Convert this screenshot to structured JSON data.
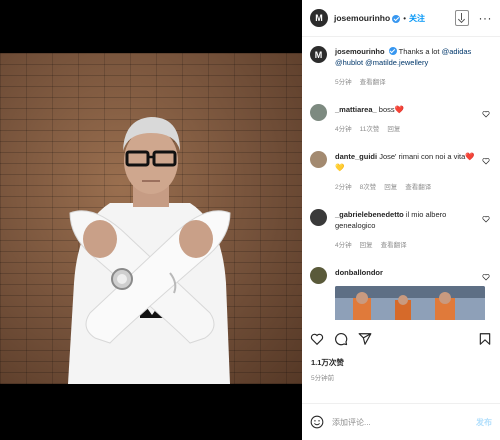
{
  "post": {
    "username": "josemourinho",
    "avatar_initial": "M",
    "follow_label": "关注",
    "dot": "•",
    "more_label": "···",
    "caption": {
      "text": "Thanks a lot ",
      "mentions": [
        "@adidas",
        "@hublot",
        "@matilde.jewellery"
      ],
      "time": "5分钟",
      "translate": "查看翻译"
    },
    "comments": [
      {
        "user": "_mattiarea_",
        "text": "boss",
        "emoji": "❤️",
        "time": "4分钟",
        "likes": "11次赞",
        "reply": "回复"
      },
      {
        "user": "dante_guidi",
        "text": "Jose' rimani con noi a vita",
        "emoji": "❤️💛",
        "time": "2分钟",
        "likes": "8次赞",
        "reply": "回复",
        "translate": "查看翻译"
      },
      {
        "user": "_gabrielebenedetto",
        "text": "il mio albero genealogico",
        "emoji": "",
        "time": "4分钟",
        "reply": "回复",
        "translate": "查看翻译"
      },
      {
        "user": "donballondor",
        "text": "",
        "emoji": "",
        "time": ""
      }
    ],
    "likes": "1.1万次赞",
    "ago": "5分钟前",
    "add_comment_placeholder": "添加评论...",
    "post_button": "发布"
  },
  "icons": {
    "download": "download-icon",
    "heart": "heart-icon",
    "comment": "comment-icon",
    "share": "share-icon",
    "bookmark": "bookmark-icon",
    "emoji": "emoji-icon",
    "verified": "verified-badge-icon"
  },
  "colors": {
    "accent": "#0095f6",
    "verified": "#3897f0",
    "post_button_disabled": "#b2dffc"
  }
}
